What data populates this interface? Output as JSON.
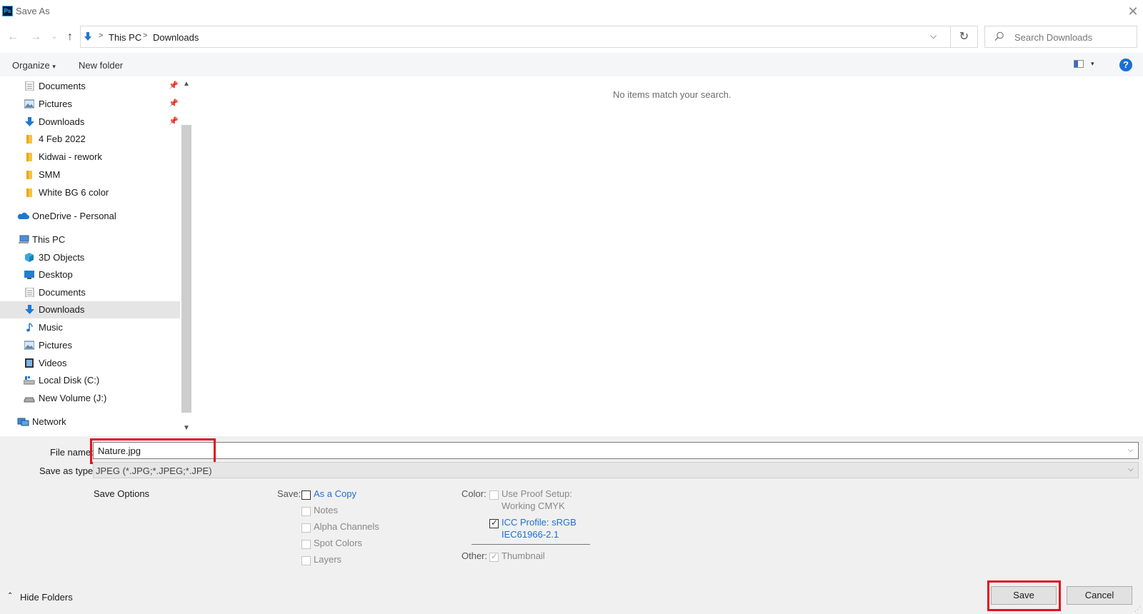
{
  "window": {
    "title": "Save As",
    "app_logo": "Ps"
  },
  "address_bar": {
    "crumbs": [
      "This PC",
      "Downloads"
    ],
    "separator": ">"
  },
  "search": {
    "placeholder": "Search Downloads"
  },
  "toolbar": {
    "organize_label": "Organize",
    "new_folder_label": "New folder",
    "help_label": "?"
  },
  "sidebar": {
    "quick_access": [
      {
        "label": "Documents",
        "icon": "documents-icon",
        "pinned": true
      },
      {
        "label": "Pictures",
        "icon": "pictures-icon",
        "pinned": true
      },
      {
        "label": "Downloads",
        "icon": "downloads-icon",
        "pinned": true
      },
      {
        "label": "4 Feb 2022",
        "icon": "folder-icon"
      },
      {
        "label": "Kidwai - rework",
        "icon": "folder-icon"
      },
      {
        "label": "SMM",
        "icon": "folder-icon"
      },
      {
        "label": "White BG 6 color",
        "icon": "folder-icon"
      }
    ],
    "onedrive": "OneDrive - Personal",
    "this_pc": "This PC",
    "this_pc_items": [
      {
        "label": "3D Objects",
        "icon": "3d-objects-icon"
      },
      {
        "label": "Desktop",
        "icon": "desktop-icon"
      },
      {
        "label": "Documents",
        "icon": "documents-icon"
      },
      {
        "label": "Downloads",
        "icon": "downloads-icon",
        "selected": true
      },
      {
        "label": "Music",
        "icon": "music-icon"
      },
      {
        "label": "Pictures",
        "icon": "pictures-icon"
      },
      {
        "label": "Videos",
        "icon": "videos-icon"
      },
      {
        "label": "Local Disk (C:)",
        "icon": "local-disk-icon"
      },
      {
        "label": "New Volume (J:)",
        "icon": "drive-icon"
      }
    ],
    "network": "Network"
  },
  "content": {
    "empty_message": "No items match your search."
  },
  "form": {
    "file_name_label": "File name:",
    "file_name_value": "Nature.jpg",
    "save_as_type_label": "Save as type:",
    "save_as_type_value": "JPEG (*.JPG;*.JPEG;*.JPE)"
  },
  "save_options": {
    "title": "Save Options",
    "save_label": "Save:",
    "as_a_copy": "As a Copy",
    "notes": "Notes",
    "alpha_channels": "Alpha Channels",
    "spot_colors": "Spot Colors",
    "layers": "Layers",
    "color_label": "Color:",
    "use_proof_setup": "Use Proof Setup:",
    "working_cmyk": "Working CMYK",
    "icc_profile": "ICC Profile:  sRGB",
    "icc_profile_2": "IEC61966-2.1",
    "icc_checked": true,
    "other_label": "Other:",
    "thumbnail": "Thumbnail"
  },
  "footer": {
    "hide_folders": "Hide Folders",
    "save_button": "Save",
    "cancel_button": "Cancel"
  },
  "colors": {
    "accent": "#1a6fd4",
    "highlight": "#e0131f",
    "selection": "#e5e5e5"
  }
}
